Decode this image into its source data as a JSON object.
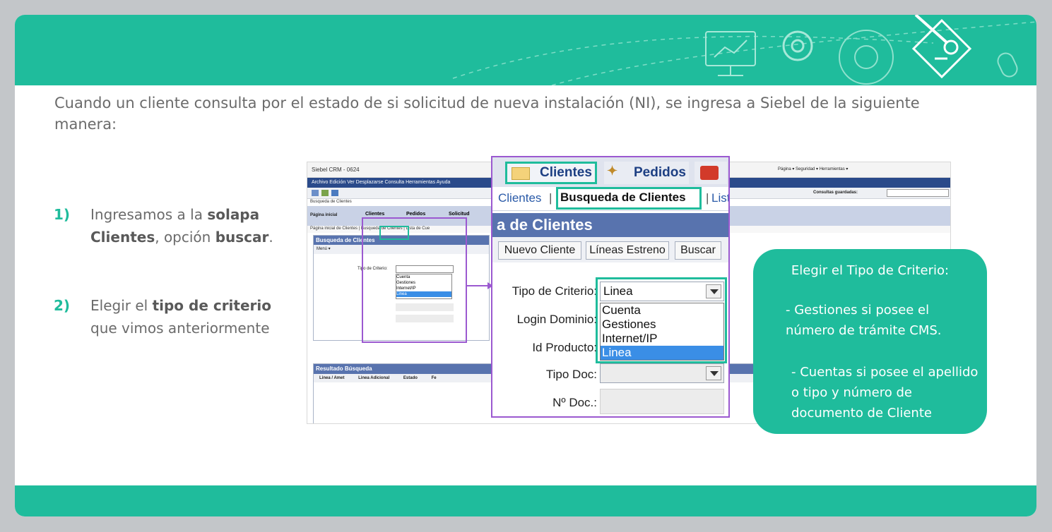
{
  "intro": "Cuando un cliente consulta por el estado de si solicitud de nueva instalación (NI), se ingresa a Siebel de la siguiente manera:",
  "steps": [
    {
      "num": "1)",
      "pre": "Ingresamos a la ",
      "b1": "solapa Clientes",
      "mid": ", opción ",
      "b2": "buscar",
      "post": "."
    },
    {
      "num": "2)",
      "pre": "Elegir el ",
      "b1": "tipo de criterio",
      "mid": " que vimos anteriormente",
      "b2": "",
      "post": ""
    }
  ],
  "siebel": {
    "window_title": "Siebel CRM - 0624",
    "menu": "Archivo   Edición   Ver   Desplazarse   Consulta   Herramientas   Ayuda",
    "ie_bar": "Página ▾   Seguridad ▾   Herramientas ▾",
    "saved_queries": "Consultas guardadas:",
    "crumb": "Busqueda de Clientes",
    "home_tab": "Página inicial",
    "tab_clientes": "Clientes",
    "tab_pedidos": "Pedidos",
    "tab_solicitud": "Solicitud",
    "subtabs": "Página inicial de Clientes  |  Busqueda de Clientes  |  Lista de Cue",
    "panel_title": "Busqueda de Clientes",
    "menu_btn": "Menú ▾",
    "results_title": "Resultado Búsqueda",
    "results_cols": [
      "Linea / Amet",
      "Linea Adicional",
      "Estado",
      "Fe"
    ]
  },
  "zoom": {
    "tab_clientes": "Clientes",
    "tab_pedidos": "Pedidos",
    "sub_clientes": "Clientes",
    "sub_busqueda": "Busqueda de Clientes",
    "sub_list": "List",
    "header": "a de Clientes",
    "btn_nuevo": "Nuevo Cliente",
    "btn_lineas": "Líneas Estreno",
    "btn_buscar": "Buscar",
    "lbl_tipo": "Tipo de Criterio:",
    "lbl_login": "Login Dominio:",
    "lbl_id": "Id Producto:",
    "lbl_tipodoc": "Tipo Doc:",
    "lbl_ndoc": "Nº Doc.:",
    "selected": "Linea",
    "options": [
      "Cuenta",
      "Gestiones",
      "Internet/IP",
      "Linea"
    ]
  },
  "callout": {
    "title": "Elegir el Tipo de Criterio:",
    "bullet1": "-    Gestiones si posee el número de trámite CMS.",
    "bullet2": "-    Cuentas si posee el apellido o tipo y número de documento de Cliente"
  },
  "colors": {
    "accent": "#1fbc9c",
    "highlight_purple": "#9b59d0",
    "siebel_blue": "#5873ae"
  }
}
